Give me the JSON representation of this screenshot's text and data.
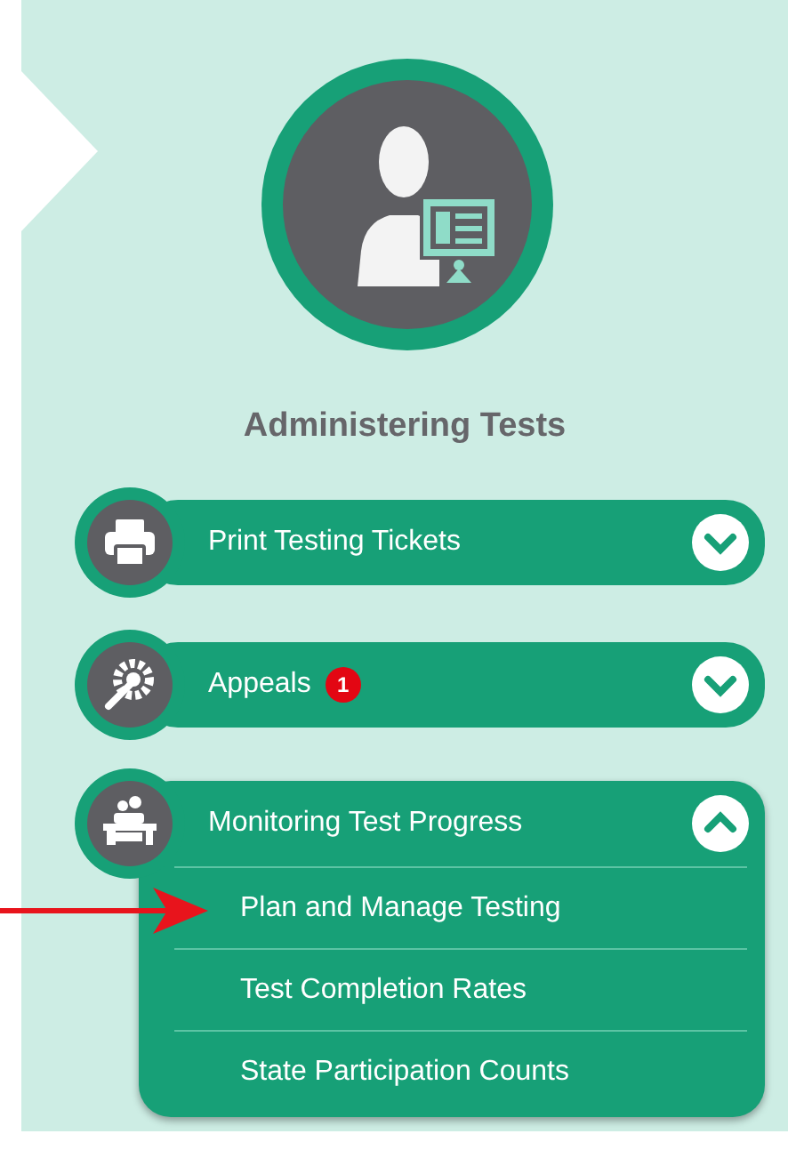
{
  "title": "Administering Tests",
  "sections": [
    {
      "label": "Print Testing Tickets",
      "expanded": false
    },
    {
      "label": "Appeals",
      "badge": "1",
      "expanded": false
    },
    {
      "label": "Monitoring Test Progress",
      "expanded": true,
      "children": [
        {
          "label": "Plan and Manage Testing",
          "marked": true
        },
        {
          "label": "Test Completion Rates",
          "marked": false
        },
        {
          "label": "State Participation Counts",
          "marked": false
        }
      ]
    }
  ]
}
